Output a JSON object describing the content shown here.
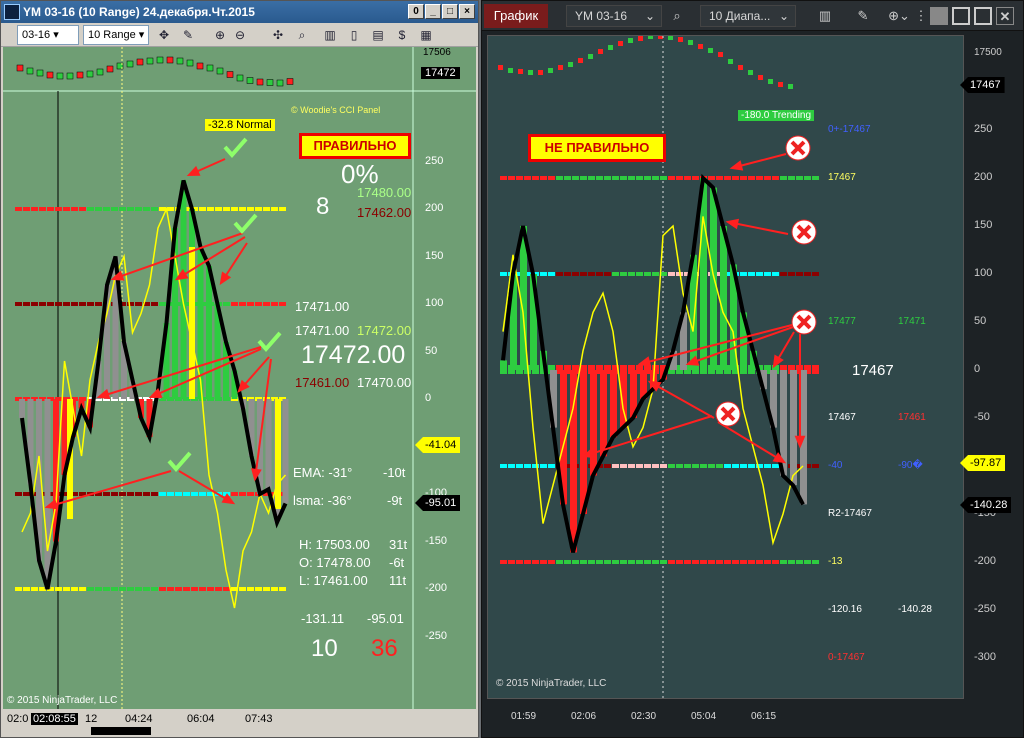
{
  "left_window": {
    "title": "YM 03-16 (10 Range)  24.декабря.Чт.2015",
    "window_buttons": [
      "0",
      "_",
      "□",
      "×"
    ],
    "toolbar": {
      "instrument": "03-16",
      "period": "10 Range"
    },
    "price_axis": {
      "top": "17506",
      "current": "17472"
    },
    "cci_axis_ticks": [
      "250",
      "200",
      "150",
      "100",
      "50",
      "0",
      "-50",
      "-100",
      "-150",
      "-200",
      "-250"
    ],
    "tags": {
      "cci1": "-41.04",
      "cci2": "-95.01"
    },
    "panel": {
      "copyright": "© Woodie's CCI Panel",
      "box_label": "-32.8 Normal",
      "ok_label": "ПРАВИЛЬНО",
      "pct": "0%",
      "count": "8",
      "v1": "17480.00",
      "v2": "17462.00",
      "p1": "17471.00",
      "p2a": "17471.00",
      "p2b": "17472.00",
      "big": "17472.00",
      "p3a": "17461.00",
      "p3b": "17470.00",
      "ema_l": "EMA: -31°",
      "ema_r": "-10t",
      "lsma_l": "lsma: -36°",
      "lsma_r": "-9t",
      "h_l": "H: 17503.00",
      "h_r": "31t",
      "o_l": "O: 17478.00",
      "o_r": "-6t",
      "l_l": "L: 17461.00",
      "l_r": "11t",
      "c1": "-131.11",
      "c2": "-95.01",
      "n1": "10",
      "n2": "36"
    },
    "ninja_copyright": "© 2015 NinjaTrader, LLC",
    "time_axis": {
      "t0": "02:0",
      "cursor": "02:08:55",
      "t1": "12",
      "t2": "04:24",
      "t3": "06:04",
      "t4": "07:43"
    }
  },
  "right_window": {
    "tab": "График",
    "instrument": "YM 03-16",
    "period": "10 Диапа...",
    "price_axis": {
      "top": "17500",
      "tag": "17467"
    },
    "cci_axis_ticks": [
      "250",
      "200",
      "150",
      "100",
      "50",
      "0",
      "-50",
      "-100",
      "-150",
      "-200",
      "-250",
      "-300"
    ],
    "tags": {
      "cci1": "-97.87",
      "cci2": "-140.28"
    },
    "panel": {
      "trend_box": "-180.0 Trending",
      "bad_label": "НЕ ПРАВИЛЬНО",
      "r1": "0+-17467",
      "r2": "17467",
      "g1": "17477",
      "g2": "17471",
      "mid": "17467",
      "m1": "17467",
      "m2": "17461",
      "b1": "-40",
      "b2": "-90�",
      "r3": "R2-17467",
      "y1": "-13",
      "w1": "-120.16",
      "w2": "-140.28",
      "red1": "0-17467"
    },
    "ninja_copyright": "© 2015 NinjaTrader, LLC",
    "time_axis": [
      "01:59",
      "02:06",
      "02:30",
      "05:04",
      "06:15"
    ]
  },
  "colors": {
    "left_bg": "#6f9e74",
    "right_bg": "#30484a",
    "cci": "#000000",
    "tcci": "#ffff00",
    "up": "#2ecc40",
    "down": "#ff2020"
  }
}
